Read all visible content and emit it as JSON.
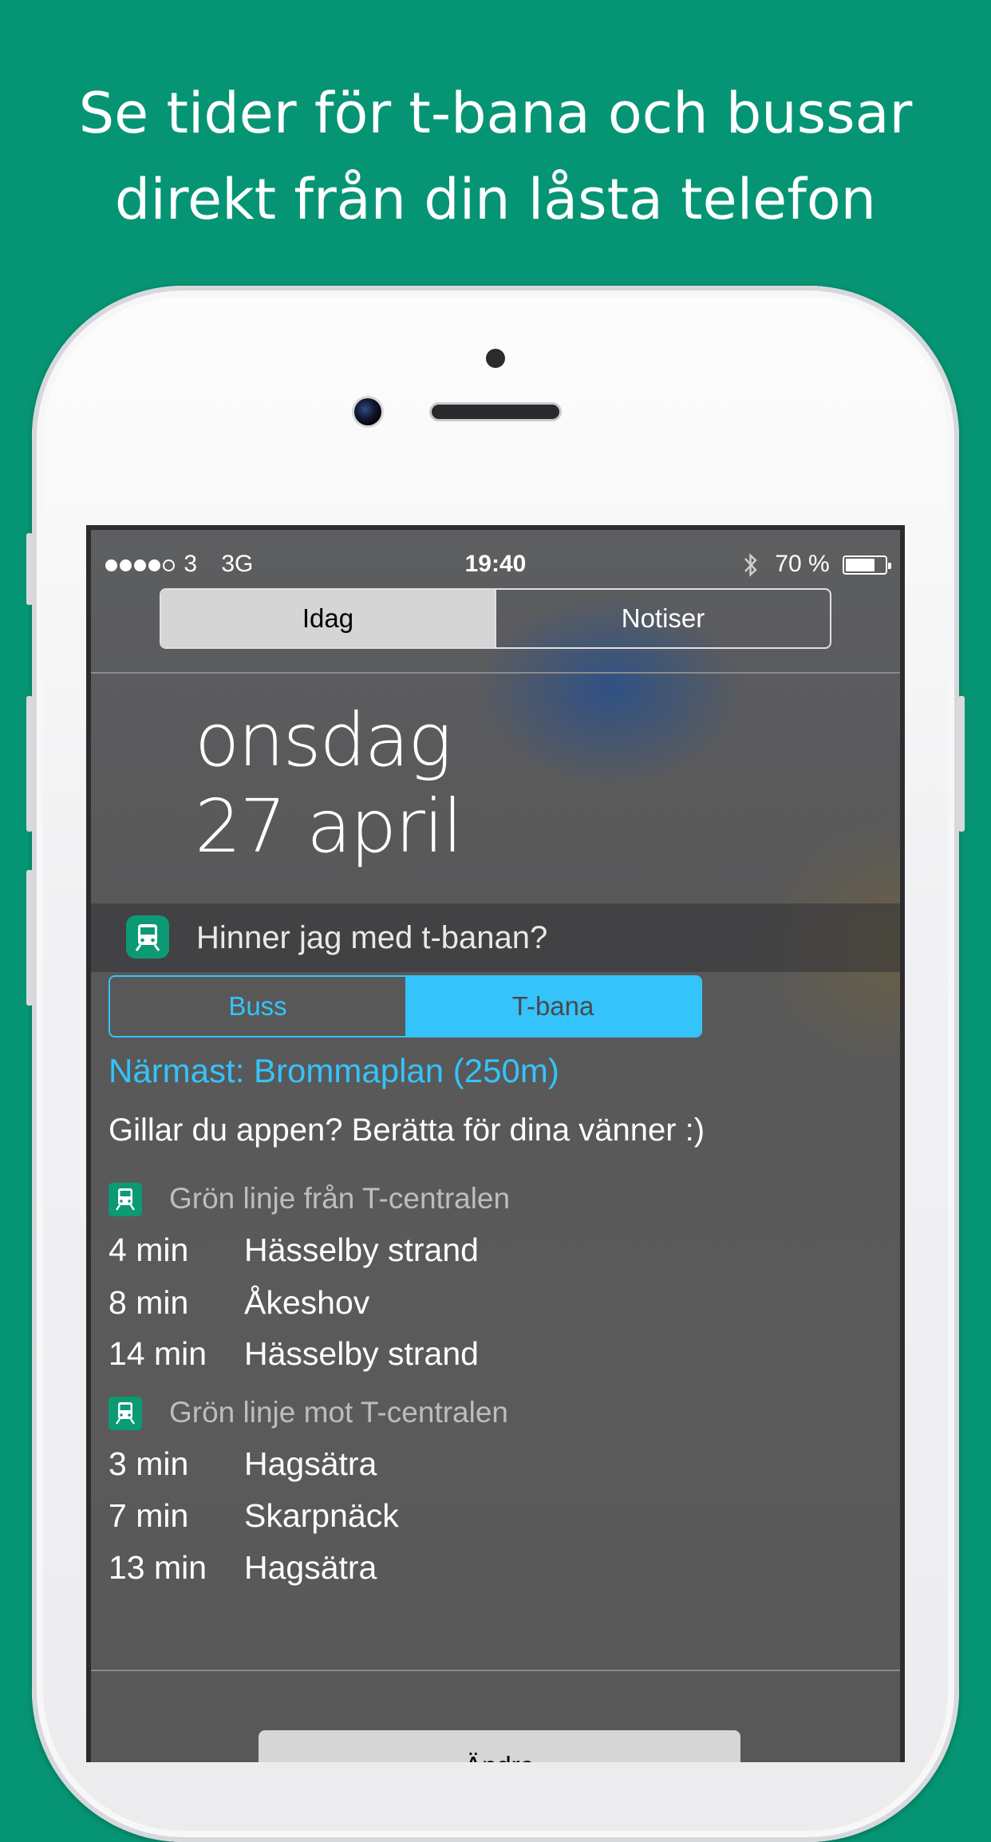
{
  "headline": {
    "line1": "Se tider för t-bana och bussar",
    "line2": "direkt från din låsta telefon"
  },
  "status_bar": {
    "carrier": "3",
    "network": "3G",
    "time": "19:40",
    "battery": "70 %"
  },
  "top_segment": {
    "today": "Idag",
    "notifications": "Notiser"
  },
  "date": {
    "weekday": "onsdag",
    "day": "27 april"
  },
  "widget": {
    "title": "Hinner jag med t-banan?",
    "modes": {
      "bus": "Buss",
      "metro": "T-bana"
    },
    "selected_mode": "T-bana",
    "nearest": "Närmast: Brommaplan (250m)",
    "promo": "Gillar du appen? Berätta för dina vänner :)",
    "directions": [
      {
        "label": "Grön linje från T-centralen",
        "departures": [
          {
            "mins": "4 min",
            "dest": "Hässelby strand"
          },
          {
            "mins": "8 min",
            "dest": "Åkeshov"
          },
          {
            "mins": "14 min",
            "dest": "Hässelby strand"
          }
        ]
      },
      {
        "label": "Grön linje mot T-centralen",
        "departures": [
          {
            "mins": "3 min",
            "dest": "Hagsätra"
          },
          {
            "mins": "7 min",
            "dest": "Skarpnäck"
          },
          {
            "mins": "13 min",
            "dest": "Hagsätra"
          }
        ]
      }
    ]
  },
  "edit_button": "Ändra",
  "colors": {
    "background": "#069574",
    "accent": "#35c3fb",
    "app_icon": "#0b9a73"
  }
}
